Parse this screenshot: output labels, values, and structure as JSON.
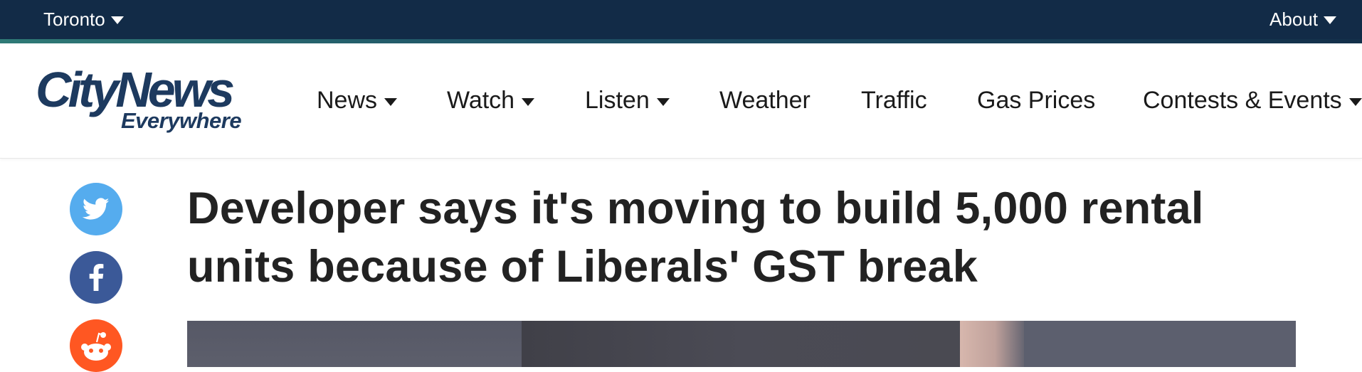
{
  "topbar": {
    "location_label": "Toronto",
    "about_label": "About"
  },
  "logo": {
    "line1": "CityNews",
    "line2": "Everywhere"
  },
  "nav": {
    "items": [
      {
        "label": "News",
        "has_dropdown": true
      },
      {
        "label": "Watch",
        "has_dropdown": true
      },
      {
        "label": "Listen",
        "has_dropdown": true
      },
      {
        "label": "Weather",
        "has_dropdown": false
      },
      {
        "label": "Traffic",
        "has_dropdown": false
      },
      {
        "label": "Gas Prices",
        "has_dropdown": false
      },
      {
        "label": "Contests & Events",
        "has_dropdown": true
      }
    ]
  },
  "share": {
    "icons": [
      "twitter-icon",
      "facebook-icon",
      "reddit-icon"
    ]
  },
  "article": {
    "headline": "Developer says it's moving to build 5,000 rental units because of Liberals' GST break"
  },
  "colors": {
    "topbar_bg": "#122b47",
    "brand_navy": "#1d3a5f",
    "twitter": "#55acee",
    "facebook": "#3b5998",
    "reddit": "#ff5722"
  }
}
